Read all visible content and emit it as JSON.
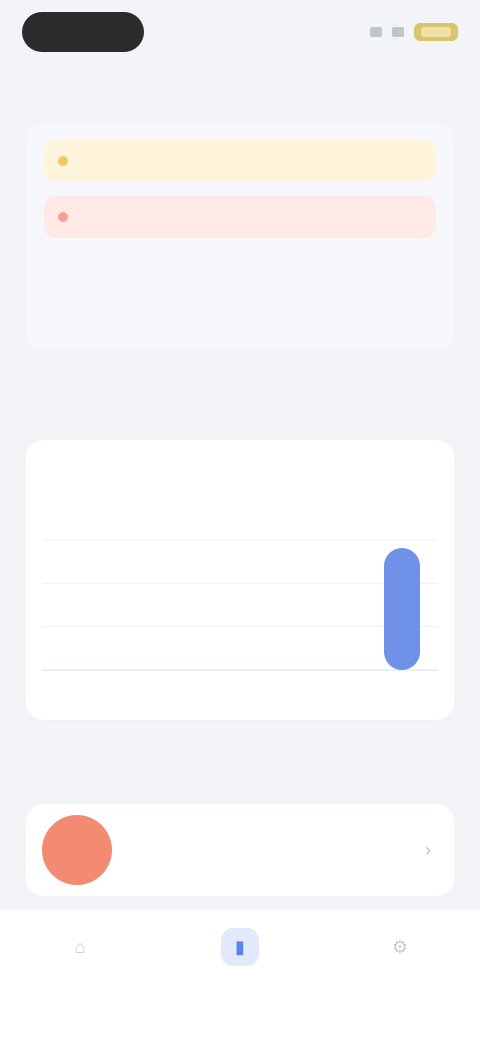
{
  "status_bar": {
    "time": "",
    "icons": [
      "signal-icon",
      "wifi-icon",
      "battery-icon"
    ]
  },
  "sections": {
    "week_title": "",
    "stats_title": ""
  },
  "week": {
    "alerts": [
      {
        "text": "",
        "tone": "warning"
      },
      {
        "text": "",
        "tone": "danger"
      }
    ],
    "days": [
      {
        "label": "",
        "date": ""
      },
      {
        "label": "",
        "date": ""
      },
      {
        "label": "",
        "date": ""
      },
      {
        "label": "",
        "date": ""
      },
      {
        "label": "",
        "date": ""
      },
      {
        "label": "",
        "date": ""
      },
      {
        "label": "",
        "date": ""
      }
    ]
  },
  "stats": {
    "items": [
      {
        "label": "",
        "value": ""
      },
      {
        "label": "",
        "value": ""
      },
      {
        "label": "",
        "value": ""
      }
    ]
  },
  "chart_data": {
    "type": "bar",
    "categories": [
      "",
      "",
      "",
      "",
      "",
      "",
      ""
    ],
    "values": [
      0,
      0,
      0,
      0,
      0,
      0,
      1
    ],
    "ylim": [
      0,
      1
    ],
    "colors": {
      "bar": "#5f86e6",
      "grid": "#eef1f6",
      "axis": "#d7dce5"
    },
    "grid": true
  },
  "list": {
    "title": "",
    "action": "",
    "items": [
      {
        "title": "",
        "subtitle": ""
      }
    ]
  },
  "tabs": [
    {
      "label": "",
      "icon": "home-icon",
      "active": false
    },
    {
      "label": "",
      "icon": "chart-icon",
      "active": true
    },
    {
      "label": "",
      "icon": "settings-icon",
      "active": false
    }
  ],
  "colors": {
    "accent": "#5884e9",
    "avatar": "#f38b73",
    "warning": "#fff4dc",
    "danger": "#ffe9e5"
  }
}
